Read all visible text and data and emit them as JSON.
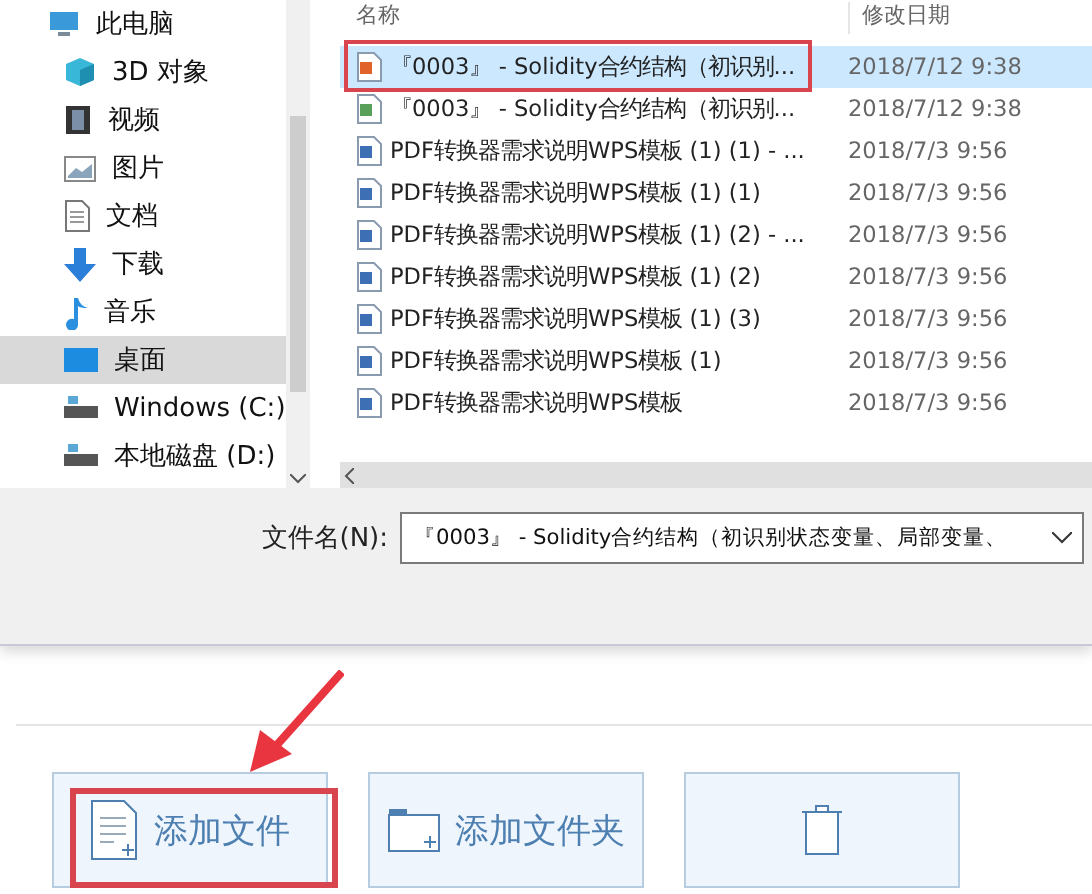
{
  "sidebar": {
    "items": [
      {
        "label": "此电脑",
        "kind": "pc",
        "selected": false
      },
      {
        "label": "3D 对象",
        "kind": "cube",
        "selected": false
      },
      {
        "label": "视频",
        "kind": "video",
        "selected": false
      },
      {
        "label": "图片",
        "kind": "image",
        "selected": false
      },
      {
        "label": "文档",
        "kind": "doc",
        "selected": false
      },
      {
        "label": "下载",
        "kind": "download",
        "selected": false
      },
      {
        "label": "音乐",
        "kind": "music",
        "selected": false
      },
      {
        "label": "桌面",
        "kind": "desktop",
        "selected": true
      },
      {
        "label": "Windows (C:)",
        "kind": "drive",
        "selected": false
      },
      {
        "label": "本地磁盘 (D:)",
        "kind": "drive",
        "selected": false
      }
    ]
  },
  "file_list": {
    "columns": [
      "名称",
      "修改日期"
    ],
    "rows": [
      {
        "name": "『0003』 -  Solidity合约结构（初识别...",
        "date": "2018/7/12 9:38",
        "kind": "orange",
        "selected": true,
        "highlighted": true
      },
      {
        "name": "『0003』 -  Solidity合约结构（初识别...",
        "date": "2018/7/12 9:38",
        "kind": "green",
        "selected": false,
        "highlighted": false
      },
      {
        "name": "PDF转换器需求说明WPS模板 (1) (1) - ...",
        "date": "2018/7/3 9:56",
        "kind": "blue",
        "selected": false,
        "highlighted": false
      },
      {
        "name": "PDF转换器需求说明WPS模板 (1) (1)",
        "date": "2018/7/3 9:56",
        "kind": "blue",
        "selected": false,
        "highlighted": false
      },
      {
        "name": "PDF转换器需求说明WPS模板 (1) (2) - ...",
        "date": "2018/7/3 9:56",
        "kind": "blue",
        "selected": false,
        "highlighted": false
      },
      {
        "name": "PDF转换器需求说明WPS模板 (1) (2)",
        "date": "2018/7/3 9:56",
        "kind": "blue",
        "selected": false,
        "highlighted": false
      },
      {
        "name": "PDF转换器需求说明WPS模板 (1) (3)",
        "date": "2018/7/3 9:56",
        "kind": "blue",
        "selected": false,
        "highlighted": false
      },
      {
        "name": "PDF转换器需求说明WPS模板 (1)",
        "date": "2018/7/3 9:56",
        "kind": "blue",
        "selected": false,
        "highlighted": false
      },
      {
        "name": "PDF转换器需求说明WPS模板",
        "date": "2018/7/3 9:56",
        "kind": "blue",
        "selected": false,
        "highlighted": false
      }
    ]
  },
  "filename_field": {
    "label": "文件名(N):",
    "value": "『0003』 -  Solidity合约结构（初识别状态变量、局部变量、"
  },
  "buttons": [
    {
      "label": "添加文件",
      "kind": "file",
      "highlighted": true
    },
    {
      "label": "添加文件夹",
      "kind": "folder",
      "highlighted": false
    },
    {
      "kind": "clear",
      "highlighted": false
    }
  ]
}
